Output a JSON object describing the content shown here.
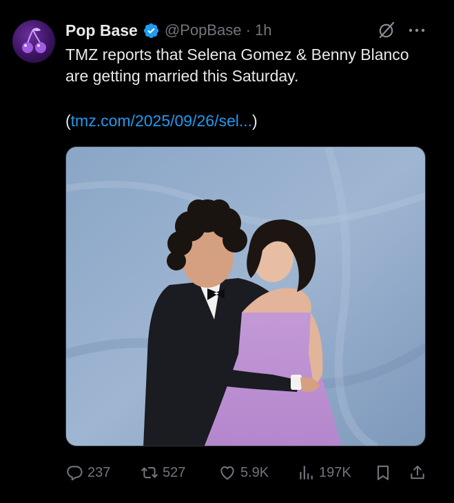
{
  "tweet": {
    "author_name": "Pop Base",
    "handle_time": "@PopBase · 1h",
    "text": "TMZ reports that Selena Gomez & Benny Blanco are getting married this Saturday.",
    "link_open": "(",
    "link_text": "tmz.com/2025/09/26/sel...",
    "link_close": ")"
  },
  "actions": {
    "replies": "237",
    "reposts": "527",
    "likes": "5.9K",
    "views": "197K"
  },
  "icons": [
    "verified-badge-icon",
    "grok-icon",
    "more-icon",
    "reply-icon",
    "repost-icon",
    "like-icon",
    "views-icon",
    "bookmark-icon",
    "share-icon"
  ],
  "colors": {
    "background": "#000000",
    "text": "#e7e9ea",
    "muted": "#71767b",
    "link": "#1d9bf0",
    "verified": "#1d9bf0"
  }
}
